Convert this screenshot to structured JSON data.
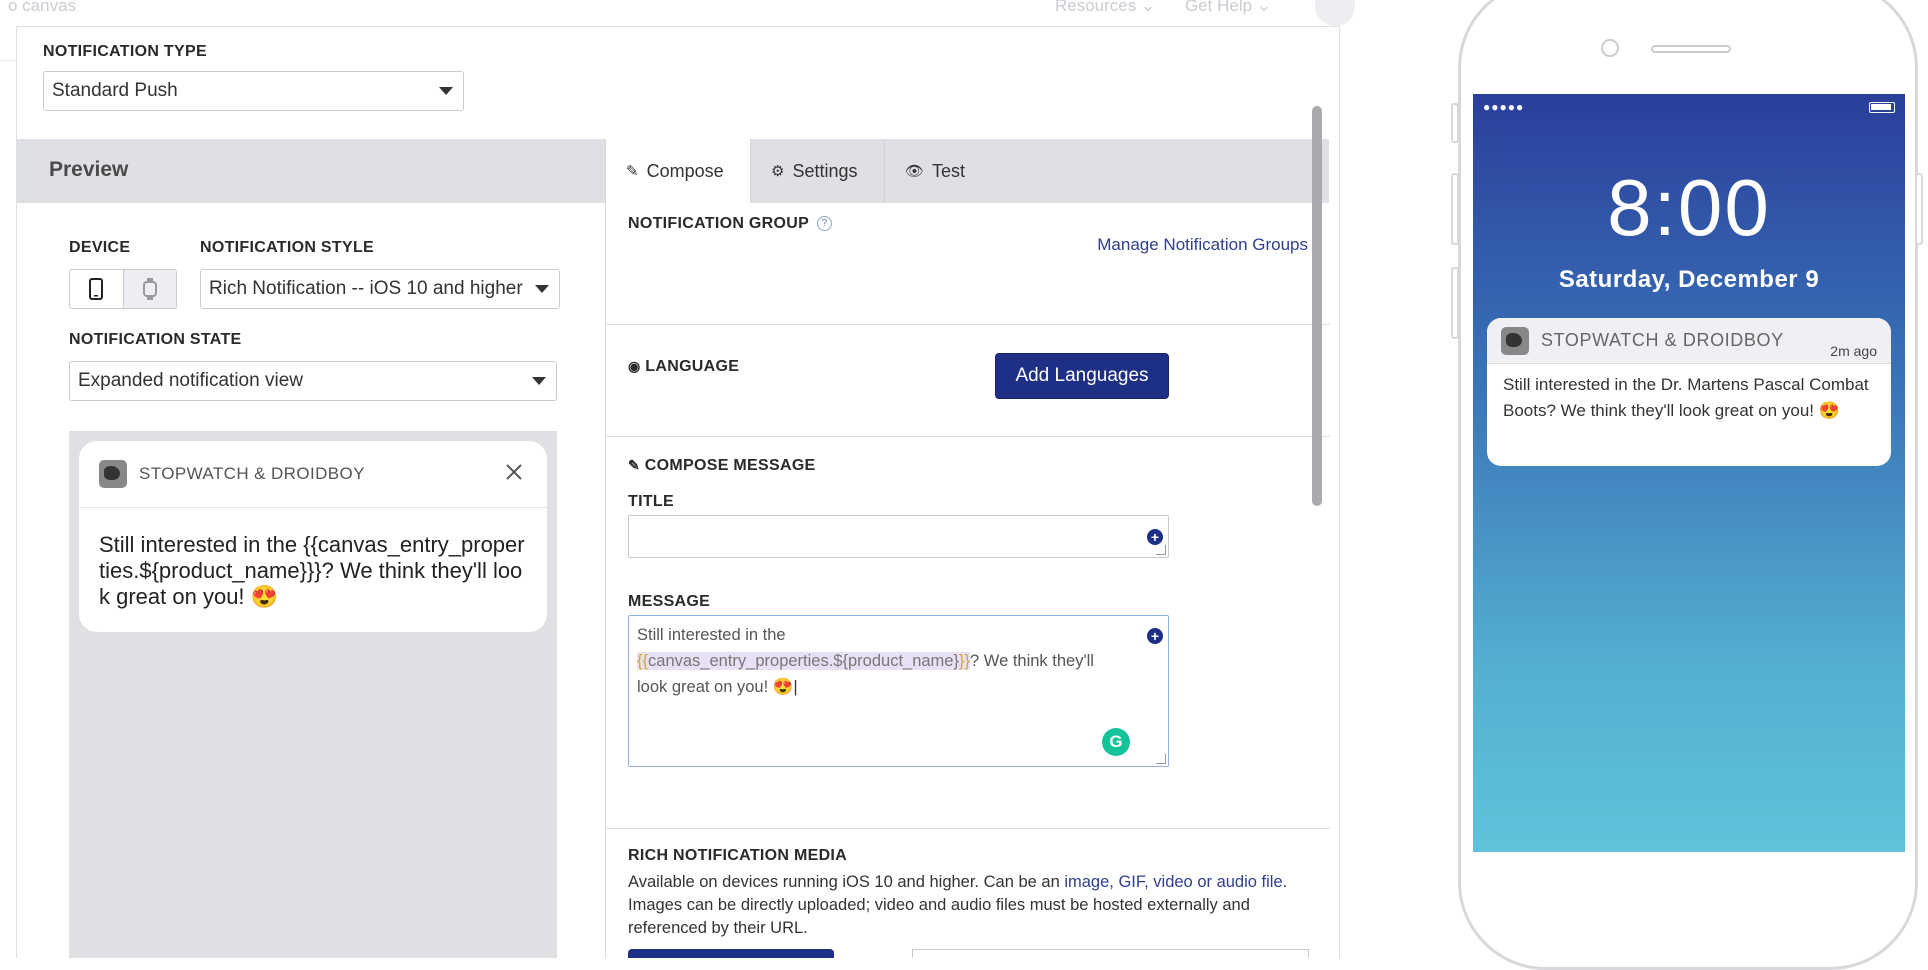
{
  "background": {
    "breadcrumb": "o canvas",
    "resources_label": "Resources",
    "get_help_label": "Get Help"
  },
  "notification_type": {
    "label": "NOTIFICATION TYPE",
    "value": "Standard Push"
  },
  "preview": {
    "header": "Preview",
    "device_label": "DEVICE",
    "device_options": [
      "phone-icon",
      "watch-icon"
    ],
    "notification_style_label": "NOTIFICATION STYLE",
    "notification_style_value": "Rich Notification -- iOS 10 and higher",
    "notification_state_label": "NOTIFICATION STATE",
    "notification_state_value": "Expanded notification view",
    "card": {
      "app_name": "STOPWATCH & DROIDBOY",
      "message": "Still interested in the {{canvas_entry_properties.${product_name}}}? We think they'll look great on you! 😍"
    }
  },
  "tabs": [
    {
      "label": "Compose",
      "icon": "pencil-icon",
      "active": true
    },
    {
      "label": "Settings",
      "icon": "gear-icon",
      "active": false
    },
    {
      "label": "Test",
      "icon": "eye-icon",
      "active": false
    }
  ],
  "compose": {
    "notification_group_label": "NOTIFICATION GROUP",
    "manage_groups_link": "Manage Notification Groups",
    "language_label": "LANGUAGE",
    "add_languages_button": "Add Languages",
    "compose_message_label": "COMPOSE MESSAGE",
    "title_label": "TITLE",
    "title_value": "",
    "message_label": "MESSAGE",
    "message_prefix": "Still interested in the ",
    "message_liquid_open": "{{",
    "message_liquid_body": "canvas_entry_properties.${product_name}",
    "message_liquid_close": "}}",
    "message_suffix": "? We think they'll look great on you! 😍",
    "rich_media_label": "RICH NOTIFICATION MEDIA",
    "rich_media_desc_1": "Available on devices running iOS 10 and higher. Can be an ",
    "rich_media_link": "image, GIF, video or audio file",
    "rich_media_desc_2": ". Images can be directly uploaded; video and audio files must be hosted externally and referenced by their URL."
  },
  "phone_preview": {
    "time": "8:00",
    "date": "Saturday, December 9",
    "app_name": "STOPWATCH & DROIDBOY",
    "ago": "2m ago",
    "message": "Still interested in the Dr. Martens Pascal Combat Boots? We think they'll look great on you! 😍"
  },
  "colors": {
    "primary": "#1e2f86",
    "link": "#2e3f8f",
    "panel_header_bg": "#dfe0e4",
    "liquid_highlight": "#e8e0f4",
    "phone_gradient_top": "#2a3f9a",
    "phone_gradient_bottom": "#60c3d9"
  }
}
